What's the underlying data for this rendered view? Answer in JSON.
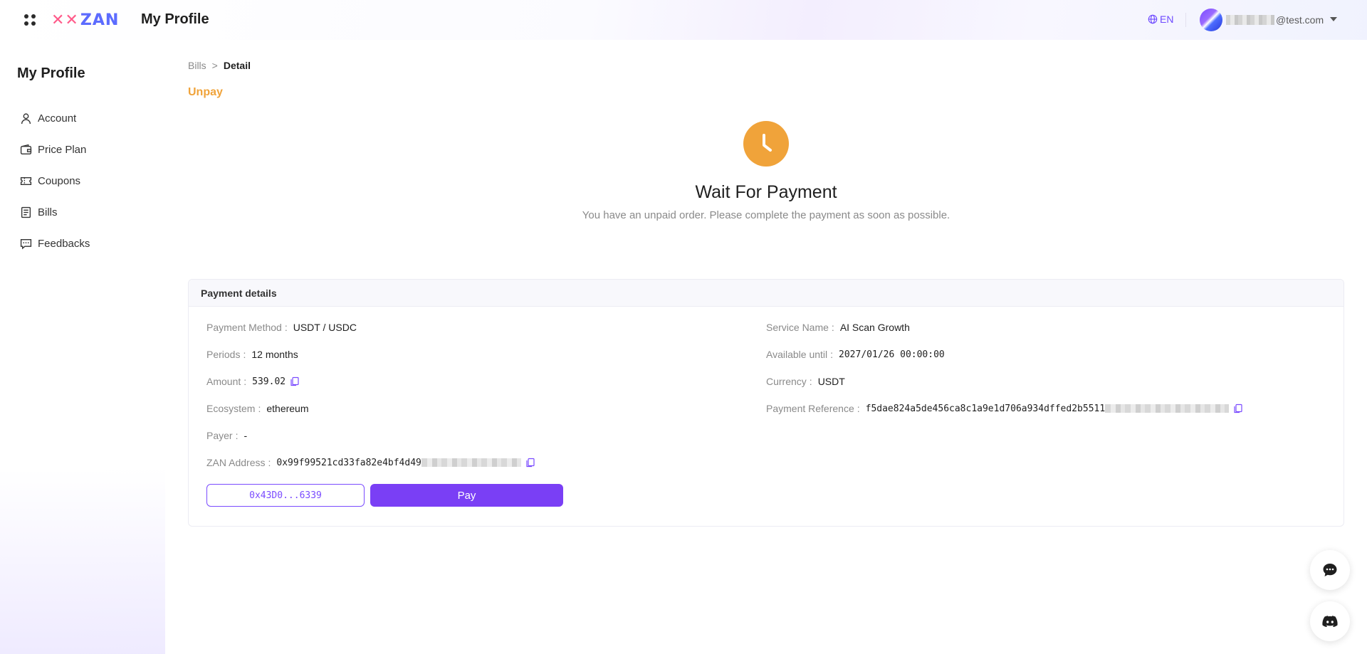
{
  "header": {
    "logo_text": "ZAN",
    "title": "My Profile",
    "language": "EN",
    "email_suffix": "@test.com"
  },
  "sidebar": {
    "title": "My Profile",
    "items": [
      {
        "label": "Account",
        "icon": "user-icon"
      },
      {
        "label": "Price Plan",
        "icon": "wallet-icon"
      },
      {
        "label": "Coupons",
        "icon": "ticket-icon"
      },
      {
        "label": "Bills",
        "icon": "document-icon"
      },
      {
        "label": "Feedbacks",
        "icon": "message-icon"
      }
    ]
  },
  "breadcrumb": {
    "parent": "Bills",
    "separator": ">",
    "current": "Detail"
  },
  "status": "Unpay",
  "notice": {
    "title": "Wait For Payment",
    "subtitle": "You have an unpaid order. Please complete the payment as soon as possible."
  },
  "payment": {
    "header": "Payment details",
    "left": [
      {
        "label": "Payment Method",
        "value": "USDT / USDC"
      },
      {
        "label": "Periods",
        "value": "12 months"
      },
      {
        "label": "Amount",
        "value": "539.02"
      },
      {
        "label": "Ecosystem",
        "value": "ethereum"
      },
      {
        "label": "Payer",
        "value": "-"
      },
      {
        "label": "ZAN Address",
        "value": "0x99f99521cd33fa82e4bf4d49"
      }
    ],
    "right": [
      {
        "label": "Service Name",
        "value": "AI Scan Growth"
      },
      {
        "label": "Available until",
        "value": "2027/01/26 00:00:00"
      },
      {
        "label": "Currency",
        "value": "USDT"
      },
      {
        "label": "Payment Reference",
        "value": "f5dae824a5de456ca8c1a9e1d706a934dffed2b5511"
      }
    ],
    "colon": ":",
    "wallet_button": "0x43D0...6339",
    "pay_button": "Pay"
  },
  "colors": {
    "accent": "#7a3ff5",
    "status": "#f0a33a"
  }
}
